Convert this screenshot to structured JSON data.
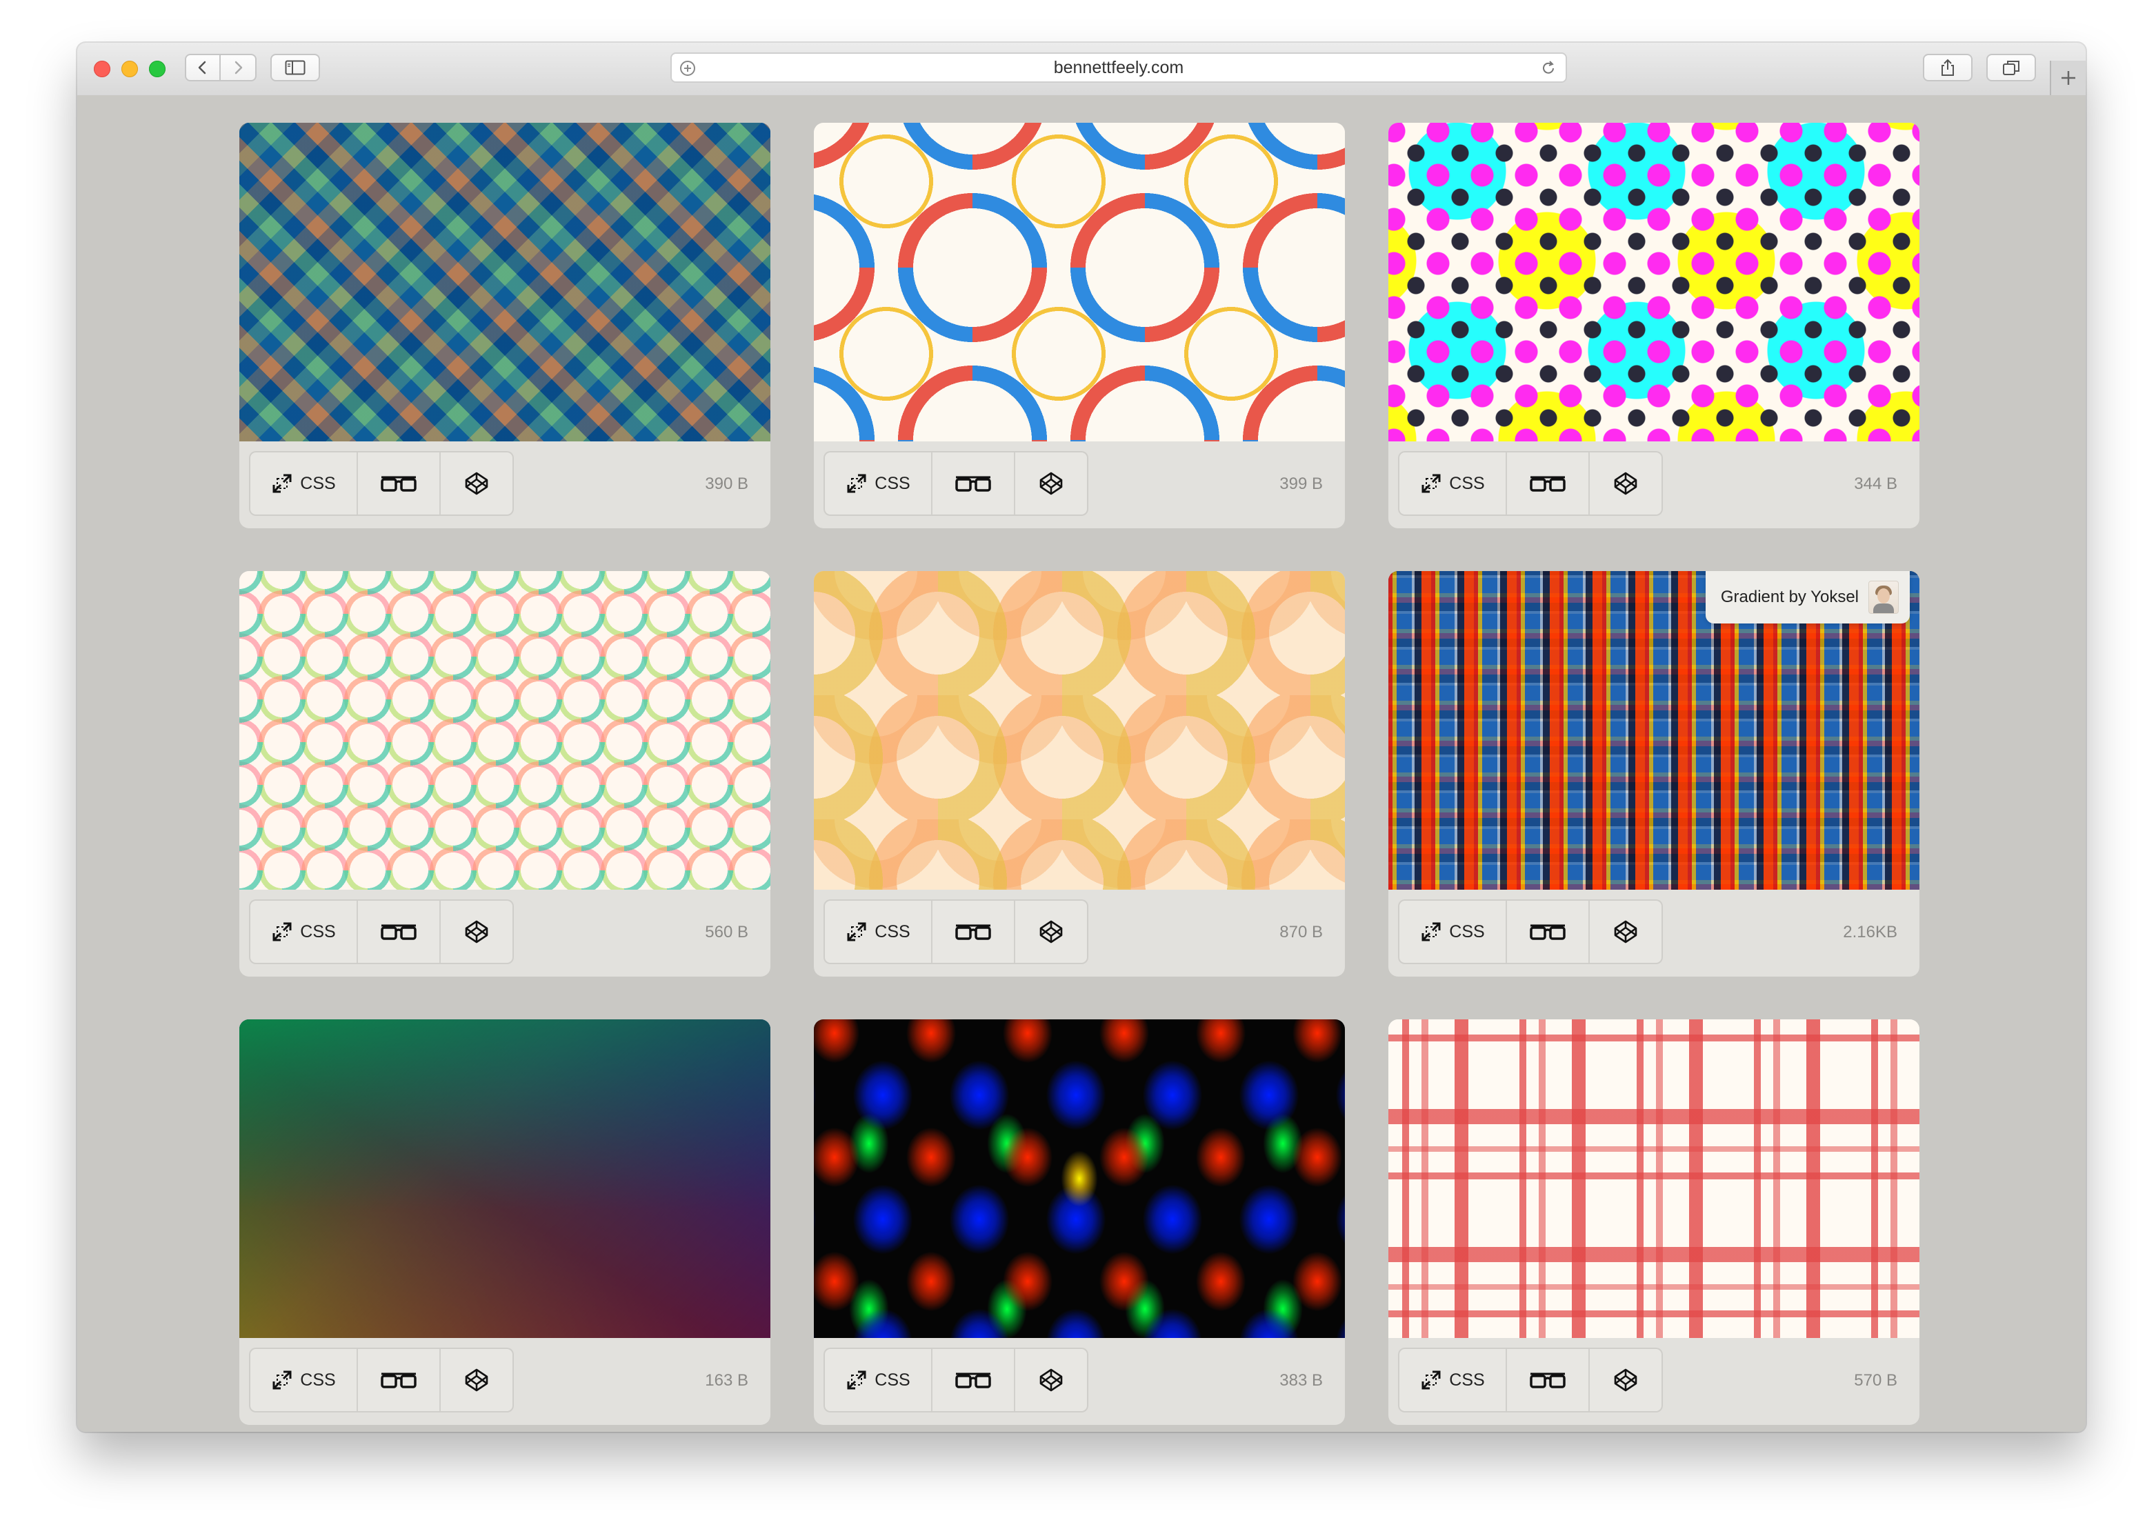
{
  "browser": {
    "url": "bennettfeely.com"
  },
  "cards": [
    {
      "css_label": "CSS",
      "size": "390 B"
    },
    {
      "css_label": "CSS",
      "size": "399 B"
    },
    {
      "css_label": "CSS",
      "size": "344 B"
    },
    {
      "css_label": "CSS",
      "size": "560 B"
    },
    {
      "css_label": "CSS",
      "size": "870 B"
    },
    {
      "css_label": "CSS",
      "size": "2.16KB",
      "credit": "Gradient by Yoksel"
    },
    {
      "css_label": "CSS",
      "size": "163 B"
    },
    {
      "css_label": "CSS",
      "size": "383 B"
    },
    {
      "css_label": "CSS",
      "size": "570 B"
    }
  ]
}
